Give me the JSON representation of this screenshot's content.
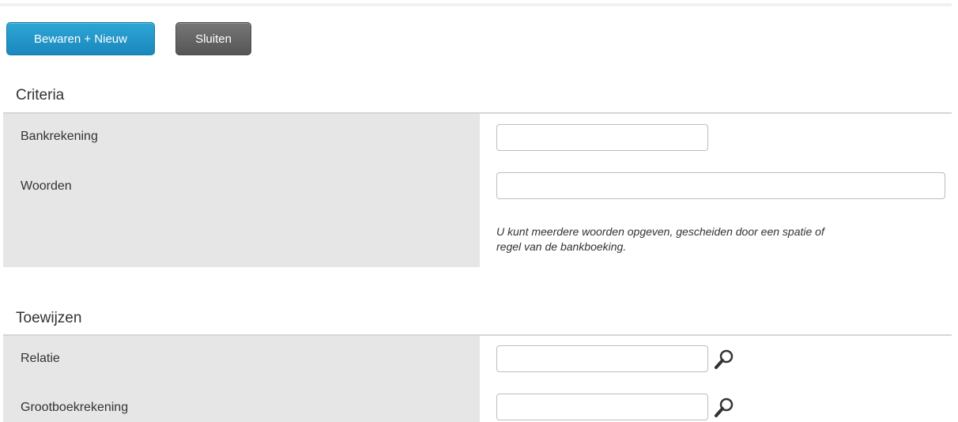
{
  "toolbar": {
    "save_new_label": "Bewaren + Nieuw",
    "close_label": "Sluiten"
  },
  "criteria": {
    "title": "Criteria",
    "bankrekening_label": "Bankrekening",
    "bankrekening_value": "",
    "woorden_label": "Woorden",
    "woorden_value": "",
    "hint_line1": "U kunt meerdere woorden opgeven, gescheiden door een spatie of",
    "hint_line2": "regel van de bankboeking."
  },
  "toewijzen": {
    "title": "Toewijzen",
    "relatie_label": "Relatie",
    "relatie_value": "",
    "grootboek_label": "Grootboekrekening",
    "grootboek_value": ""
  },
  "icons": {
    "lookup": "search-icon"
  },
  "colors": {
    "primary_button": "#1f93c8",
    "secondary_button": "#666666",
    "label_background": "#e6e6e6"
  }
}
